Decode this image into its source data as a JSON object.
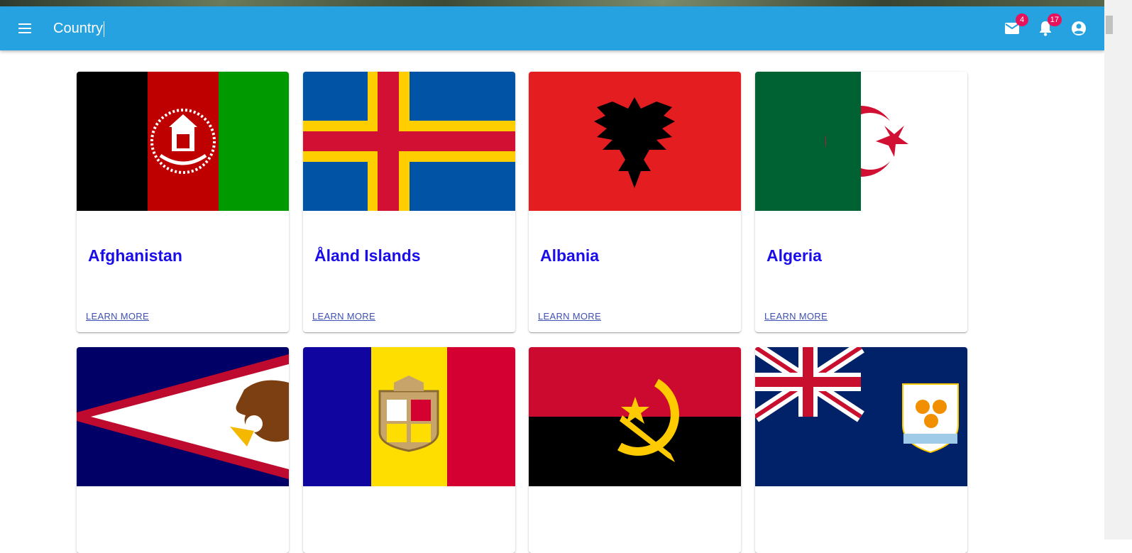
{
  "appbar": {
    "search_value": "Country",
    "mail_badge": "4",
    "notifications_badge": "17",
    "bg_color": "#27a2e0",
    "badge_color": "#e8125c"
  },
  "cards": [
    {
      "title": "Afghanistan",
      "action": "LEARN MORE",
      "flag": "afghanistan-flag"
    },
    {
      "title": "Åland Islands",
      "action": "LEARN MORE",
      "flag": "aland-islands-flag"
    },
    {
      "title": "Albania",
      "action": "LEARN MORE",
      "flag": "albania-flag"
    },
    {
      "title": "Algeria",
      "action": "LEARN MORE",
      "flag": "algeria-flag"
    },
    {
      "flag": "american-samoa-flag"
    },
    {
      "flag": "andorra-flag"
    },
    {
      "flag": "angola-flag"
    },
    {
      "flag": "anguilla-flag"
    }
  ],
  "icons": [
    "menu-icon",
    "mail-icon",
    "bell-icon",
    "account-circle-icon"
  ],
  "colors": {
    "title": "#1a0dea",
    "link": "#3f51b5"
  }
}
